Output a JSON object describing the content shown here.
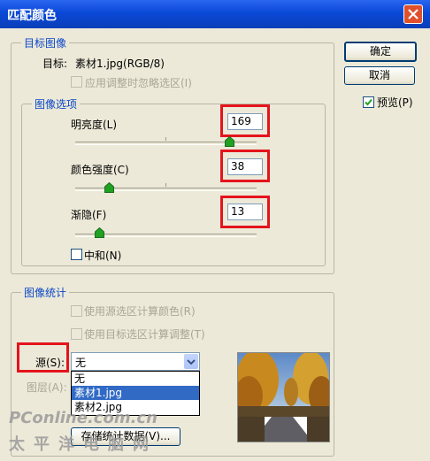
{
  "window": {
    "title": "匹配颜色",
    "close_icon": "close-icon"
  },
  "buttons": {
    "ok": "确定",
    "cancel": "取消",
    "save_stats": "存储统计数据(V)..."
  },
  "preview": {
    "label": "预览(P)",
    "checked": true
  },
  "target_image": {
    "legend": "目标图像",
    "target_label": "目标:",
    "target_value": "素材1.jpg(RGB/8)",
    "ignore_selection_label": "应用调整时忽略选区(I)"
  },
  "image_options": {
    "legend": "图像选项",
    "luminance": {
      "label": "明亮度(L)",
      "value": "169",
      "slider_fraction": 0.85
    },
    "color_intensity": {
      "label": "颜色强度(C)",
      "value": "38",
      "slider_fraction": 0.19
    },
    "fade": {
      "label": "渐隐(F)",
      "value": "13",
      "slider_fraction": 0.13
    },
    "neutralize_label": "中和(N)"
  },
  "image_stats": {
    "legend": "图像统计",
    "use_source_selection_label": "使用源选区计算颜色(R)",
    "use_target_selection_label": "使用目标选区计算调整(T)",
    "source_label": "源(S):",
    "source_value": "无",
    "layer_label": "图层(A):",
    "source_options": [
      "无",
      "素材1.jpg",
      "素材2.jpg"
    ],
    "selected_option": "素材1.jpg"
  },
  "watermark": {
    "line1": "PConline.com.cn",
    "line2": "太平洋电脑网"
  },
  "colors": {
    "titlebar": "#0a48d6",
    "legend": "#0a46c8",
    "highlight": "#316ac5",
    "annotation": "#e4141c"
  }
}
